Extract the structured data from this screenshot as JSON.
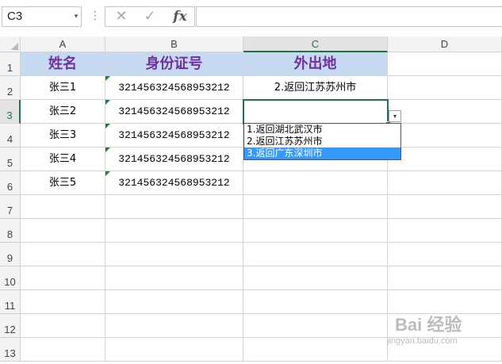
{
  "formula_bar": {
    "name_box": "C3",
    "name_box_arrow": "▾",
    "dots": "⋮",
    "cancel_glyph": "✕",
    "enter_glyph": "✓",
    "fx_label": "fx",
    "formula_value": ""
  },
  "columns": [
    "A",
    "B",
    "C",
    "D"
  ],
  "selected_column": "C",
  "rows": [
    "1",
    "2",
    "3",
    "4",
    "5",
    "6",
    "7",
    "8",
    "9",
    "10",
    "11",
    "12",
    "13"
  ],
  "selected_row": "3",
  "table": {
    "headers": [
      "姓名",
      "身份证号",
      "外出地"
    ],
    "records": [
      {
        "name": "张三1",
        "id": "321456324568953212",
        "dest": "2.返回江苏苏州市"
      },
      {
        "name": "张三2",
        "id": "321456324568953212",
        "dest": ""
      },
      {
        "name": "张三3",
        "id": "321456324568953212",
        "dest": ""
      },
      {
        "name": "张三4",
        "id": "321456324568953212",
        "dest": ""
      },
      {
        "name": "张三5",
        "id": "321456324568953212",
        "dest": ""
      }
    ]
  },
  "dropdown": {
    "arrow": "▾",
    "options": [
      "1.返回湖北武汉市",
      "2.返回江苏苏州市",
      "3.返回广东深圳市"
    ],
    "highlighted_index": 2
  },
  "colors": {
    "header_fill": "#c5d9f1",
    "header_text": "#7030a0",
    "selection": "#217346",
    "highlight": "#3399ff"
  },
  "watermark": {
    "text": "Bai 经验",
    "sub": "jingyan.baidu.com"
  }
}
